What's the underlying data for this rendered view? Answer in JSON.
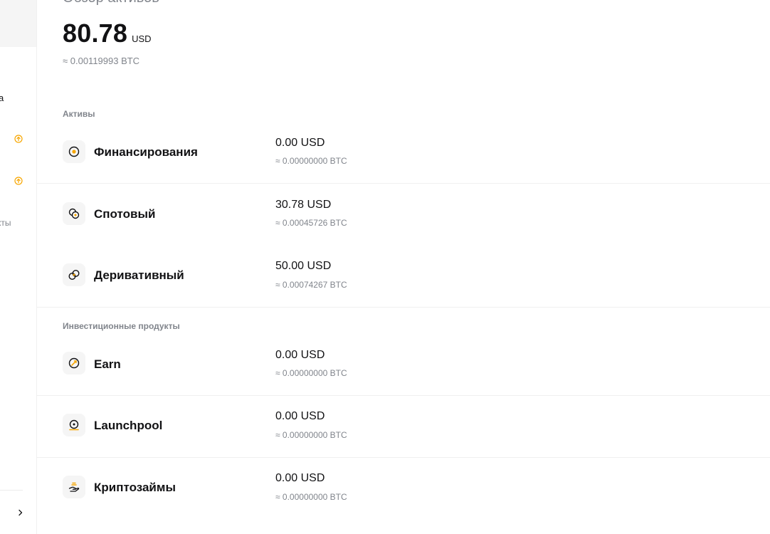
{
  "colors": {
    "accent": "#f7a600",
    "text": "#121214",
    "muted": "#81858c",
    "icon_bg": "#f5f5f5"
  },
  "sidebar": {
    "items": [
      {
        "text": "а",
        "icon": "arrow-up-circle-icon"
      },
      {
        "text": "",
        "icon": "arrow-up-circle-icon"
      },
      {
        "text": "",
        "icon": "arrow-up-circle-icon"
      },
      {
        "text": "кты",
        "icon": ""
      }
    ],
    "collapse_icon": "chevron-right-icon"
  },
  "overview": {
    "title": "Обзор активов",
    "balance_value": "80.78",
    "balance_unit": "USD",
    "balance_btc": "≈ 0.00119993 BTC"
  },
  "assets": {
    "label": "Активы",
    "items": [
      {
        "name": "Финансирования",
        "icon": "funding-icon",
        "amount": "0.00 USD",
        "btc": "≈ 0.00000000 BTC"
      },
      {
        "name": "Спотовый",
        "icon": "spot-icon",
        "amount": "30.78 USD",
        "btc": "≈ 0.00045726 BTC"
      },
      {
        "name": "Деривативный",
        "icon": "derivatives-icon",
        "amount": "50.00 USD",
        "btc": "≈ 0.00074267 BTC"
      }
    ]
  },
  "investments": {
    "label": "Инвестиционные продукты",
    "items": [
      {
        "name": "Earn",
        "icon": "earn-icon",
        "amount": "0.00 USD",
        "btc": "≈ 0.00000000 BTC"
      },
      {
        "name": "Launchpool",
        "icon": "launchpool-icon",
        "amount": "0.00 USD",
        "btc": "≈ 0.00000000 BTC"
      },
      {
        "name": "Криптозаймы",
        "icon": "crypto-loans-icon",
        "amount": "0.00 USD",
        "btc": "≈ 0.00000000 BTC"
      }
    ]
  }
}
